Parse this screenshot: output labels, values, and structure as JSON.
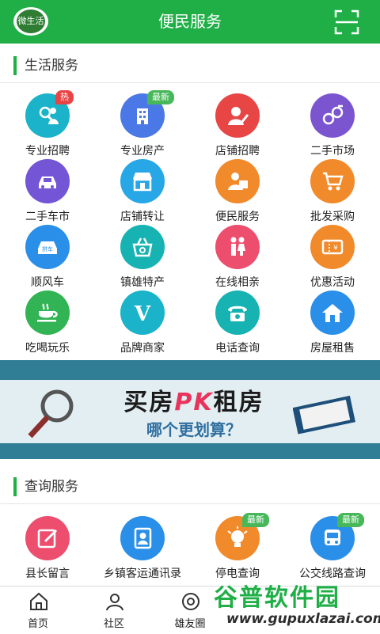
{
  "header": {
    "title": "便民服务",
    "logo_text": "微生活"
  },
  "sections": {
    "life": {
      "title": "生活服务",
      "items": [
        {
          "label": "专业招聘",
          "icon": "recruit-icon",
          "color": "#1BB3C9",
          "badge": "热"
        },
        {
          "label": "专业房产",
          "icon": "building-icon",
          "color": "#4A78E6",
          "badge": "最新"
        },
        {
          "label": "店铺招聘",
          "icon": "person-pen-icon",
          "color": "#E84545"
        },
        {
          "label": "二手市场",
          "icon": "exchange-icon",
          "color": "#7B55CF"
        },
        {
          "label": "二手车市",
          "icon": "car-icon",
          "color": "#7355D6"
        },
        {
          "label": "店铺转让",
          "icon": "shop-icon",
          "color": "#27A7E5"
        },
        {
          "label": "便民服务",
          "icon": "service-icon",
          "color": "#F18A2B"
        },
        {
          "label": "批发采购",
          "icon": "cart-icon",
          "color": "#F18A2B"
        },
        {
          "label": "顺风车",
          "icon": "carpool-icon",
          "color": "#2A8FE8"
        },
        {
          "label": "镇雄特产",
          "icon": "basket-icon",
          "color": "#17B3B3"
        },
        {
          "label": "在线相亲",
          "icon": "couple-icon",
          "color": "#EE4E6E"
        },
        {
          "label": "优惠活动",
          "icon": "ticket-icon",
          "color": "#F18A2B"
        },
        {
          "label": "吃喝玩乐",
          "icon": "coffee-icon",
          "color": "#32B455"
        },
        {
          "label": "品牌商家",
          "icon": "v-icon",
          "color": "#1BB3C9"
        },
        {
          "label": "电话查询",
          "icon": "phone-icon",
          "color": "#17B3B3"
        },
        {
          "label": "房屋租售",
          "icon": "house-icon",
          "color": "#2A8FE8"
        }
      ]
    },
    "query": {
      "title": "查询服务",
      "items": [
        {
          "label": "县长留言",
          "icon": "edit-icon",
          "color": "#EE4E6E"
        },
        {
          "label": "乡镇客运通讯录",
          "icon": "contacts-icon",
          "color": "#2A8FE8"
        },
        {
          "label": "停电查询",
          "icon": "bulb-icon",
          "color": "#F18A2B",
          "badge": "最新"
        },
        {
          "label": "公交线路查询",
          "icon": "bus-icon",
          "color": "#2A8FE8",
          "badge": "最新"
        }
      ]
    }
  },
  "banner": {
    "title_a": "买房",
    "title_pk": "PK",
    "title_b": "租房",
    "subtitle": "哪个更划算？"
  },
  "bottom_nav": [
    {
      "label": "首页",
      "icon": "home-icon"
    },
    {
      "label": "社区",
      "icon": "community-icon"
    },
    {
      "label": "雄友圈",
      "icon": "circle-icon"
    }
  ],
  "watermark": {
    "title": "谷普软件园",
    "url": "www.gupuxlazai.com"
  },
  "colors": {
    "brand": "#1FAF46",
    "badge_hot": "#E94444",
    "badge_new": "#47B85A"
  }
}
